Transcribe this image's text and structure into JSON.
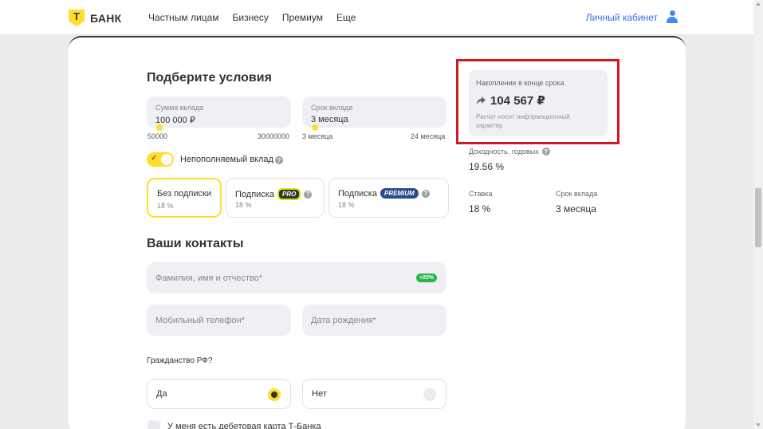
{
  "header": {
    "logo_mark": "Т",
    "logo_text": "БАНК",
    "nav": [
      "Частным лицам",
      "Бизнесу",
      "Премиум",
      "Еще"
    ],
    "cabinet_label": "Личный кабинет"
  },
  "conditions": {
    "title": "Подберите условия",
    "amount": {
      "label": "Сумма вклада",
      "value": "100 000 ₽",
      "min": "50000",
      "max": "30000000"
    },
    "term": {
      "label": "Срок вклада",
      "value": "3 месяца",
      "min": "3 месяца",
      "max": "24 месяца"
    },
    "toggle_label": "Непополняемый вклад",
    "toggle_on": true,
    "subscriptions": [
      {
        "title": "Без подписки",
        "rate": "18 %",
        "selected": true
      },
      {
        "title": "Подписка",
        "badge": "PRO",
        "rate": "18 %",
        "selected": false
      },
      {
        "title": "Подписка",
        "badge": "PREMIUM",
        "rate": "18 %",
        "selected": false
      }
    ]
  },
  "contacts": {
    "title": "Ваши контакты",
    "name_placeholder": "Фамилия, имя и отчество*",
    "name_badge": "+20%",
    "phone_placeholder": "Мобильный телефон*",
    "birth_placeholder": "Дата рождения*",
    "citizenship_question": "Гражданство РФ?",
    "citizenship_options": [
      {
        "label": "Да",
        "checked": true
      },
      {
        "label": "Нет",
        "checked": false
      }
    ],
    "debit_card_label": "У меня есть дебетовая карта Т-Банка"
  },
  "summary": {
    "label": "Накопление в конце срока",
    "value": "104 567 ₽",
    "note": "Расчет носит информационный характер",
    "yield_label": "Доходность, годовых",
    "yield_value": "19.56 %",
    "rate_label": "Ставка",
    "rate_value": "18 %",
    "term_label": "Срок вклада",
    "term_value": "3 месяца"
  },
  "colors": {
    "accent": "#ffdd2d",
    "link": "#336fee",
    "highlight": "#d7171f",
    "green": "#2cb54b"
  }
}
